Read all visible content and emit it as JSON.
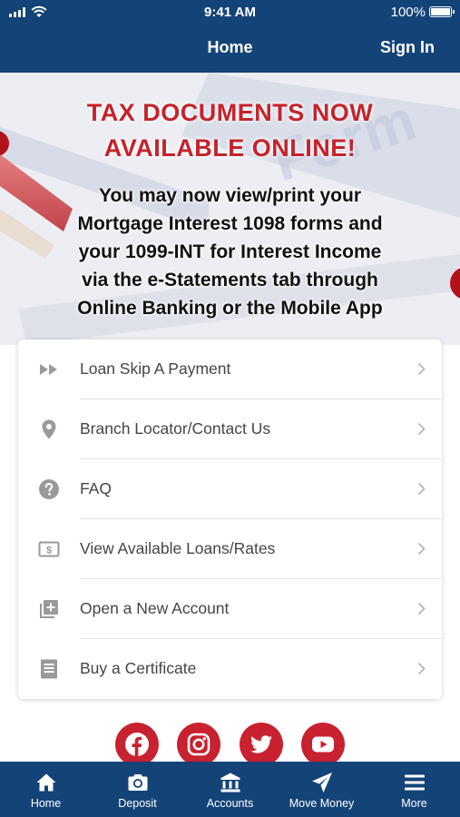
{
  "status_bar": {
    "time": "9:41 AM",
    "battery": "100%"
  },
  "nav": {
    "title": "Home",
    "sign_in": "Sign In"
  },
  "banner": {
    "headline_line1": "TAX DOCUMENTS NOW",
    "headline_line2": "AVAILABLE ONLINE!",
    "body_lines": [
      "You may now view/print your",
      "Mortgage Interest 1098 forms and",
      "your 1099-INT for Interest Income",
      "via the e-Statements tab through",
      "Online Banking or the Mobile App"
    ]
  },
  "menu": {
    "items": [
      {
        "label": "Loan Skip A Payment",
        "icon": "fast-forward-icon"
      },
      {
        "label": "Branch Locator/Contact Us",
        "icon": "map-pin-icon"
      },
      {
        "label": "FAQ",
        "icon": "question-circle-icon"
      },
      {
        "label": "View Available Loans/Rates",
        "icon": "dollar-bill-icon"
      },
      {
        "label": "Open a New Account",
        "icon": "add-box-icon"
      },
      {
        "label": "Buy a Certificate",
        "icon": "certificate-icon"
      }
    ]
  },
  "social": [
    "facebook-icon",
    "instagram-icon",
    "twitter-icon",
    "youtube-icon"
  ],
  "tabs": [
    {
      "label": "Home",
      "icon": "home-icon"
    },
    {
      "label": "Deposit",
      "icon": "camera-icon"
    },
    {
      "label": "Accounts",
      "icon": "bank-icon"
    },
    {
      "label": "Move Money",
      "icon": "send-icon"
    },
    {
      "label": "More",
      "icon": "menu-icon"
    }
  ],
  "colors": {
    "brand_blue": "#144378",
    "accent_red": "#c8212f",
    "headline_red": "#c4232b",
    "icon_gray": "#9a9a9a"
  }
}
